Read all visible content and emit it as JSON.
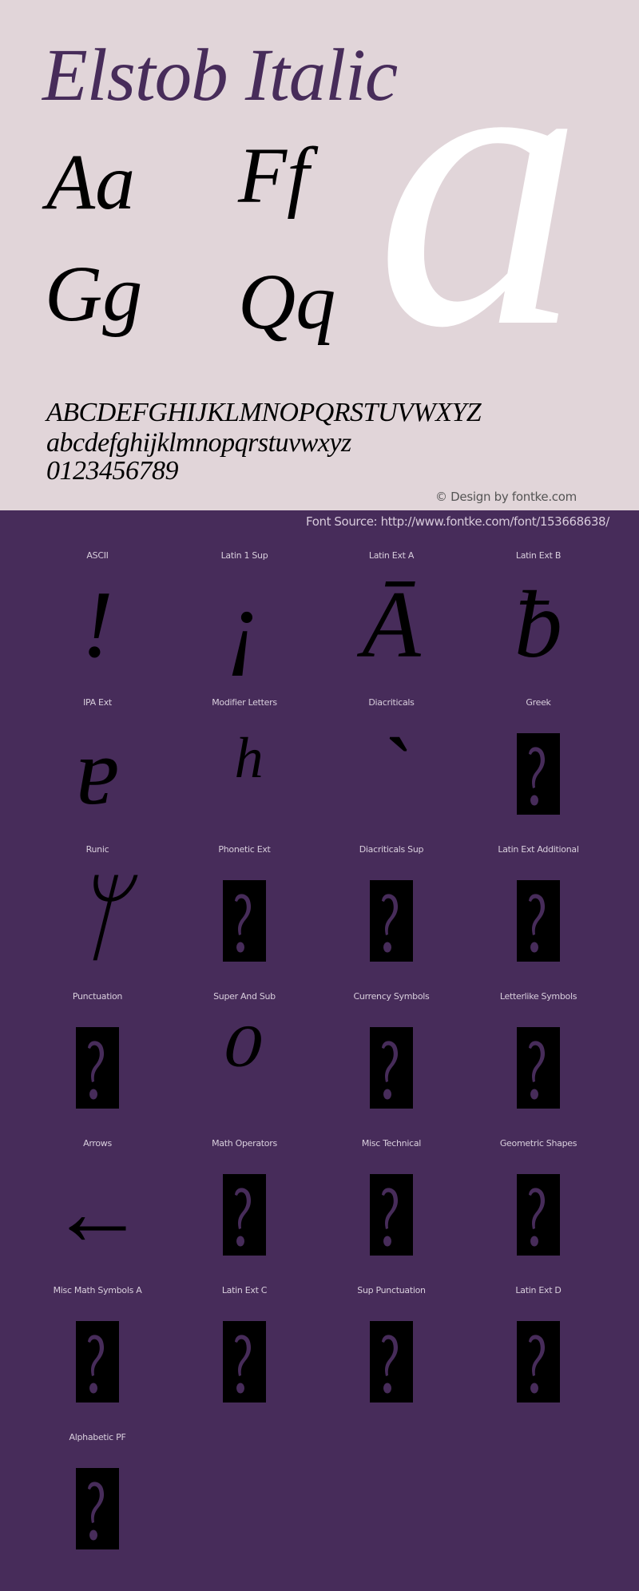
{
  "header": {
    "title": "Elstob Italic",
    "pairs": [
      "Aa",
      "Ff",
      "Gg",
      "Qq"
    ],
    "big_glyph": "a",
    "uppercase": "ABCDEFGHIJKLMNOPQRSTUVWXYZ",
    "lowercase": "abcdefghijklmnopqrstuvwxyz",
    "digits": "0123456789",
    "copyright": "© Design by fontke.com"
  },
  "source": {
    "text": "Font Source: http://www.fontke.com/font/153668638/"
  },
  "colors": {
    "top_background": "#e1d5d9",
    "bottom_background": "#472c5a",
    "title": "#472c5a",
    "big_glyph": "#ffffff"
  },
  "blocks": [
    {
      "label": "ASCII",
      "glyph": "!",
      "missing": false
    },
    {
      "label": "Latin 1 Sup",
      "glyph": "¡",
      "missing": false
    },
    {
      "label": "Latin Ext A",
      "glyph": "Ā",
      "missing": false
    },
    {
      "label": "Latin Ext B",
      "glyph": "ƀ",
      "missing": false
    },
    {
      "label": "IPA Ext",
      "glyph": "ɐ",
      "missing": false
    },
    {
      "label": "Modifier Letters",
      "glyph": "ʰ",
      "missing": false
    },
    {
      "label": "Diacriticals",
      "glyph": "`",
      "missing": false
    },
    {
      "label": "Greek",
      "glyph": "",
      "missing": true
    },
    {
      "label": "Runic",
      "glyph": "ᛘ",
      "missing": false
    },
    {
      "label": "Phonetic Ext",
      "glyph": "",
      "missing": true
    },
    {
      "label": "Diacriticals Sup",
      "glyph": "",
      "missing": true
    },
    {
      "label": "Latin Ext Additional",
      "glyph": "",
      "missing": true
    },
    {
      "label": "Punctuation",
      "glyph": "",
      "missing": true
    },
    {
      "label": "Super And Sub",
      "glyph": "⁰",
      "missing": false
    },
    {
      "label": "Currency Symbols",
      "glyph": "",
      "missing": true
    },
    {
      "label": "Letterlike Symbols",
      "glyph": "",
      "missing": true
    },
    {
      "label": "Arrows",
      "glyph": "←",
      "missing": false
    },
    {
      "label": "Math Operators",
      "glyph": "",
      "missing": true
    },
    {
      "label": "Misc Technical",
      "glyph": "",
      "missing": true
    },
    {
      "label": "Geometric Shapes",
      "glyph": "",
      "missing": true
    },
    {
      "label": "Misc Math Symbols A",
      "glyph": "",
      "missing": true
    },
    {
      "label": "Latin Ext C",
      "glyph": "",
      "missing": true
    },
    {
      "label": "Sup Punctuation",
      "glyph": "",
      "missing": true
    },
    {
      "label": "Latin Ext D",
      "glyph": "",
      "missing": true
    },
    {
      "label": "Alphabetic PF",
      "glyph": "",
      "missing": true
    }
  ]
}
